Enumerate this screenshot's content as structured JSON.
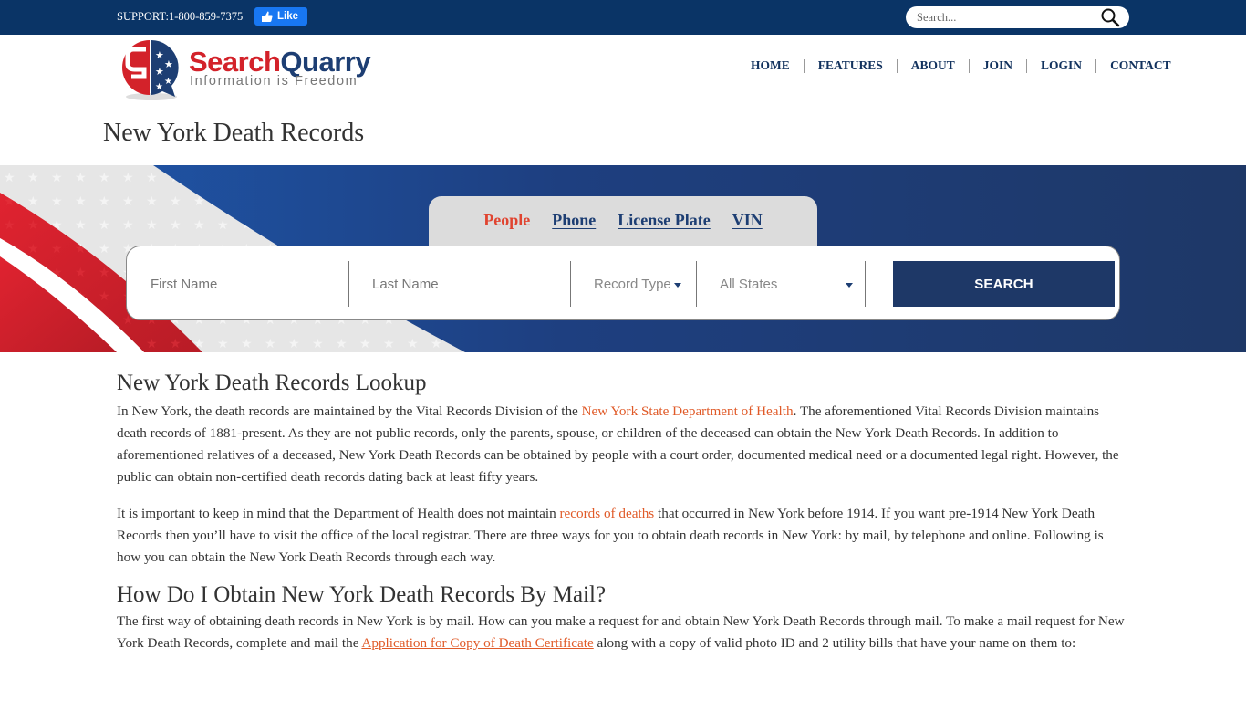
{
  "topbar": {
    "support_label": "SUPPORT:1-800-859-7375",
    "like_label": "Like",
    "search_placeholder": "Search..."
  },
  "logo": {
    "brand_part1": "Search",
    "brand_part2": "Quarry",
    "tagline": "Information is Freedom"
  },
  "nav": {
    "items": [
      {
        "label": "HOME"
      },
      {
        "label": "FEATURES"
      },
      {
        "label": "ABOUT"
      },
      {
        "label": "JOIN"
      },
      {
        "label": "LOGIN"
      },
      {
        "label": "CONTACT"
      }
    ]
  },
  "page": {
    "title": "New York Death Records"
  },
  "search": {
    "tabs": [
      {
        "label": "People",
        "active": true
      },
      {
        "label": "Phone",
        "active": false
      },
      {
        "label": "License Plate",
        "active": false
      },
      {
        "label": "VIN",
        "active": false
      }
    ],
    "first_name_placeholder": "First Name",
    "last_name_placeholder": "Last Name",
    "record_type_label": "Record Type",
    "state_selected": "All States",
    "button_label": "SEARCH"
  },
  "colors": {
    "navy": "#0a3466",
    "brand_blue": "#1e3867",
    "brand_red": "#d3222a",
    "link_orange": "#e05a28",
    "tab_active": "#e04430"
  },
  "article": {
    "h_lookup": "New York Death Records Lookup",
    "p1_a": "In New York, the death records are maintained by the Vital Records Division of the ",
    "p1_link": "New York State Department of Health",
    "p1_b": ". The aforementioned Vital Records Division maintains death records of 1881-present. As they are not public records, only the parents, spouse, or children of the deceased can obtain the New York Death Records. In addition to aforementioned relatives of a deceased, New York Death Records can be obtained by people with a court order, documented medical need or a documented legal right. However, the public can obtain non-certified death records dating back at least fifty years.",
    "p2_a": "It is important to keep in mind that the Department of Health does not maintain ",
    "p2_link": "records of deaths",
    "p2_b": " that occurred in New York before 1914. If you want pre-1914 New York Death Records then you’ll have to visit the office of the local registrar. There are three ways for you to obtain death records in New York: by mail, by telephone and online. Following is how you can obtain the New York Death Records through each way.",
    "h_mail": "How Do I Obtain New York Death Records By Mail?",
    "p3_a": "The first way of obtaining death records in New York is by mail. How can you make a request for and obtain New York Death Records through mail. To make a mail request for New York Death Records, complete and mail the ",
    "p3_link": "Application for Copy of Death Certificate",
    "p3_b": " along with a copy of valid photo ID and 2 utility bills that have your name on them to:"
  }
}
